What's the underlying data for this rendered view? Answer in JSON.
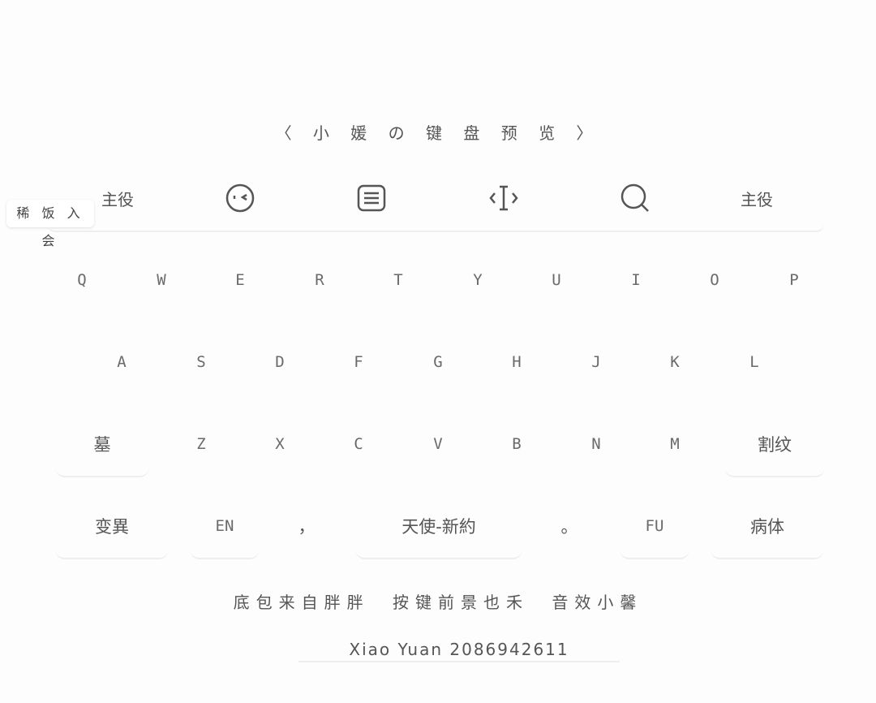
{
  "header": {
    "title": "〈 小 媛 の 键 盘 预 览 〉"
  },
  "side_tag": {
    "label": "稀 饭 入 会"
  },
  "toolbar": {
    "left_label": "主役",
    "right_label": "主役",
    "icons": [
      "emoji-face-icon",
      "keyboard-icon",
      "text-cursor-icon",
      "search-icon"
    ]
  },
  "rows": {
    "row1": [
      "Q",
      "W",
      "E",
      "R",
      "T",
      "Y",
      "U",
      "I",
      "O",
      "P"
    ],
    "row2": [
      "A",
      "S",
      "D",
      "F",
      "G",
      "H",
      "J",
      "K",
      "L"
    ],
    "row3": {
      "shift": "墓",
      "keys": [
        "Z",
        "X",
        "C",
        "V",
        "B",
        "N",
        "M"
      ],
      "delete": "割纹"
    },
    "row4": {
      "symbols": "变異",
      "lang": "EN",
      "comma": "，",
      "space": "天使-新約",
      "period": "。",
      "fu": "FU",
      "enter": "病体"
    }
  },
  "footer": {
    "credits": "底包来自胖胖 按键前景也禾 音效小馨",
    "signature": "Xiao Yuan 2086942611"
  }
}
